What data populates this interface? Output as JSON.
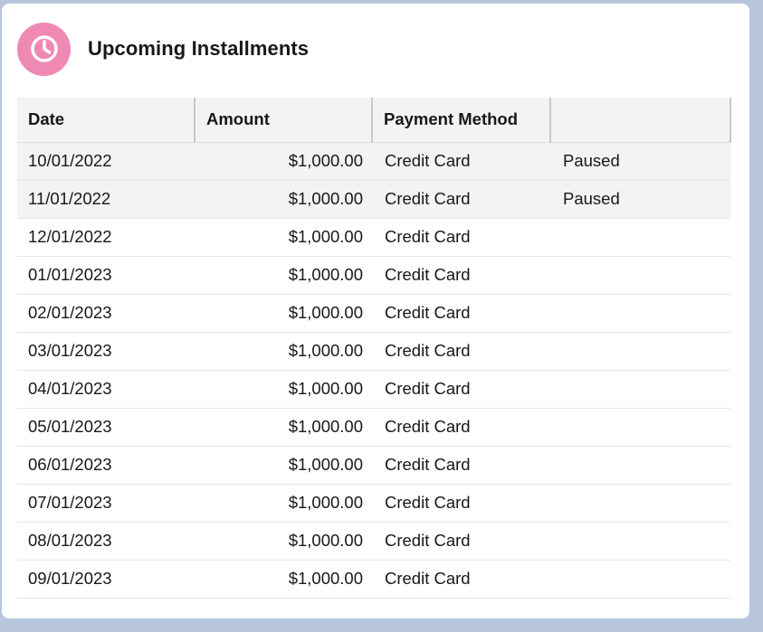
{
  "card": {
    "title": "Upcoming Installments",
    "icon": "clock-icon",
    "icon_color": "#f088b4"
  },
  "table": {
    "columns": [
      "Date",
      "Amount",
      "Payment Method",
      ""
    ],
    "rows": [
      {
        "date": "10/01/2022",
        "amount": "$1,000.00",
        "method": "Credit Card",
        "status": "Paused"
      },
      {
        "date": "11/01/2022",
        "amount": "$1,000.00",
        "method": "Credit Card",
        "status": "Paused"
      },
      {
        "date": "12/01/2022",
        "amount": "$1,000.00",
        "method": "Credit Card",
        "status": ""
      },
      {
        "date": "01/01/2023",
        "amount": "$1,000.00",
        "method": "Credit Card",
        "status": ""
      },
      {
        "date": "02/01/2023",
        "amount": "$1,000.00",
        "method": "Credit Card",
        "status": ""
      },
      {
        "date": "03/01/2023",
        "amount": "$1,000.00",
        "method": "Credit Card",
        "status": ""
      },
      {
        "date": "04/01/2023",
        "amount": "$1,000.00",
        "method": "Credit Card",
        "status": ""
      },
      {
        "date": "05/01/2023",
        "amount": "$1,000.00",
        "method": "Credit Card",
        "status": ""
      },
      {
        "date": "06/01/2023",
        "amount": "$1,000.00",
        "method": "Credit Card",
        "status": ""
      },
      {
        "date": "07/01/2023",
        "amount": "$1,000.00",
        "method": "Credit Card",
        "status": ""
      },
      {
        "date": "08/01/2023",
        "amount": "$1,000.00",
        "method": "Credit Card",
        "status": ""
      },
      {
        "date": "09/01/2023",
        "amount": "$1,000.00",
        "method": "Credit Card",
        "status": ""
      }
    ]
  }
}
